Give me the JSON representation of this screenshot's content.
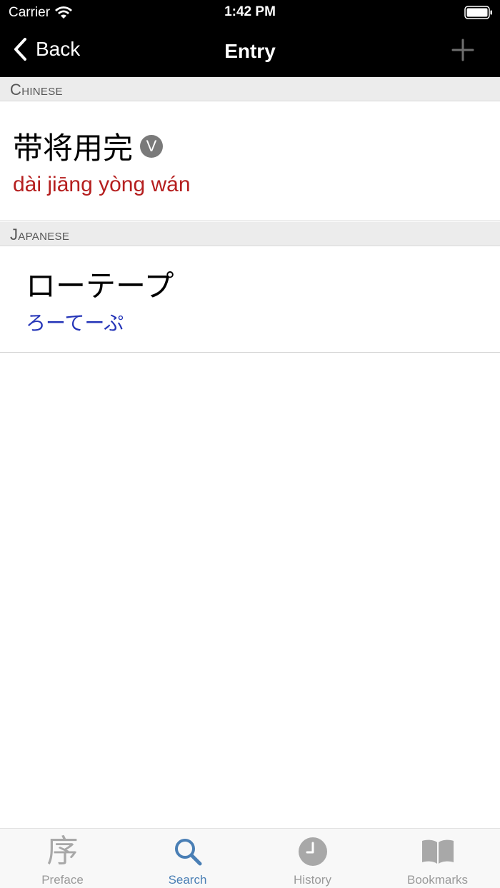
{
  "status_bar": {
    "carrier": "Carrier",
    "time": "1:42 PM"
  },
  "nav": {
    "back_label": "Back",
    "title": "Entry"
  },
  "sections": {
    "chinese": {
      "header": "Chinese",
      "word": "带将用完",
      "badge": "V",
      "pinyin": "dài jiāng yòng wán"
    },
    "japanese": {
      "header": "Japanese",
      "word": "ローテープ",
      "reading": "ろーてーぷ"
    }
  },
  "tabs": [
    {
      "label": "Preface",
      "icon": "preface-glyph-icon",
      "glyph": "序",
      "active": false
    },
    {
      "label": "Search",
      "icon": "search-icon",
      "active": true
    },
    {
      "label": "History",
      "icon": "clock-icon",
      "active": false
    },
    {
      "label": "Bookmarks",
      "icon": "book-icon",
      "active": false
    }
  ],
  "colors": {
    "pinyin": "#b51f1f",
    "kana": "#2535b8",
    "tab_active": "#4a7fb5",
    "tab_inactive": "#9a9a9a",
    "nav_background": "#000000"
  }
}
